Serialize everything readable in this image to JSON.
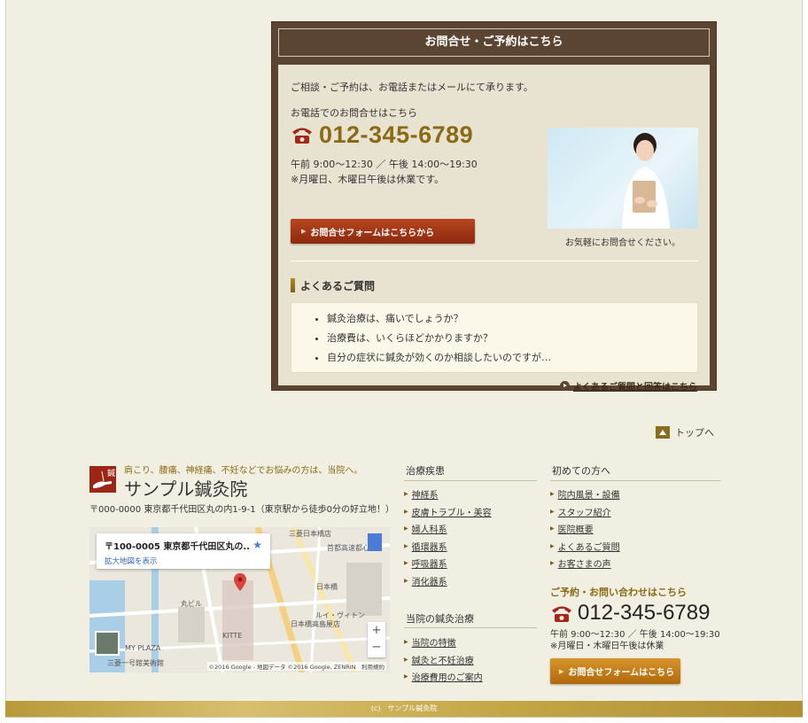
{
  "contact": {
    "heading": "お問合せ・ご予約はこちら",
    "intro": "ご相談・ご予約は、お電話またはメールにて承ります。",
    "tel_label": "お電話でのお問合せはこちら",
    "tel_number": "012-345-6789",
    "hours_line1": "午前 9:00〜12:30 ／ 午後 14:00〜19:30",
    "hours_line2": "※月曜日、木曜日午後は休業です。",
    "form_button": "お問合せフォームはこちらから",
    "photo_caption": "お気軽にお問合せください。"
  },
  "faq": {
    "title": "よくあるご質問",
    "items": [
      "鍼灸治療は、痛いでしょうか？",
      "治療費は、いくらほどかかりますか？",
      "自分の症状に鍼灸が効くのか相談したいのですが…"
    ],
    "more_link": "よくあるご質問と回答はこちら"
  },
  "to_top": "トップへ",
  "footer": {
    "logo_char": "鍼",
    "catch": "肩こり、腰痛、神経痛、不妊などでお悩みの方は、当院へ。",
    "clinic_name": "サンプル鍼灸院",
    "address": "〒000-0000 東京都千代田区丸の内1-9-1（東京駅から徒歩0分の好立地！）",
    "map": {
      "card_title": "〒100-0005 東京都千代田区丸の...",
      "card_link": "拡大地図を表示",
      "labels": [
        "三菱日本橋店",
        "首都高速都心環",
        "日本橋",
        "丸ビル",
        "KITTE",
        "ルイ・ヴィトン",
        "日本橋高島屋店",
        "三菱一号館美術館",
        "MY PLAZA"
      ],
      "attribution": "©2016 Google - 地図データ ©2016 Google, ZENRIN　利用規約"
    },
    "col1": {
      "heading": "治療疾患",
      "items": [
        "神経系",
        "皮膚トラブル・美容",
        "婦人科系",
        "循環器系",
        "呼吸器系",
        "消化器系"
      ]
    },
    "col2": {
      "heading": "当院の鍼灸治療",
      "items": [
        "当院の特徴",
        "鍼灸と不妊治療",
        "治療費用のご案内"
      ]
    },
    "col3": {
      "heading": "初めての方へ",
      "items": [
        "院内風景・設備",
        "スタッフ紹介",
        "医院概要",
        "よくあるご質問",
        "お客さまの声"
      ]
    },
    "contact_title": "ご予約・お問い合わせはこちら",
    "tel_number": "012-345-6789",
    "hours_line1": "午前 9:00〜12:30 ／ 午後 14:00〜19:30",
    "hours_line2": "※月曜日・木曜日午後は休業",
    "form_button": "お問合せフォームはこちら"
  },
  "copyright": "(c)　サンプル鍼灸院",
  "colors": {
    "panel_brown": "#5b4432",
    "gold": "#8b6a16",
    "button_red": "#9b2a10",
    "button_orange": "#c67c1a",
    "page_bg": "#f1efe2"
  }
}
